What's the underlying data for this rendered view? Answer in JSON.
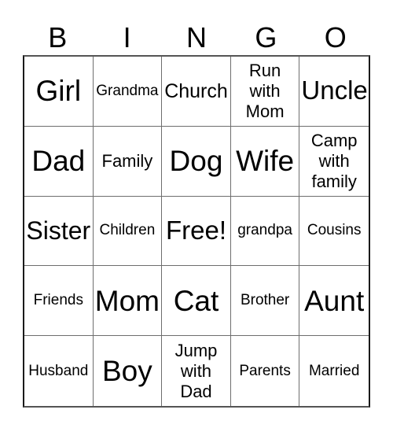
{
  "card": {
    "title": "BINGO",
    "header_letters": [
      "B",
      "I",
      "N",
      "G",
      "O"
    ],
    "rows": 5,
    "columns": 5,
    "free_space": "Free!",
    "colors": {
      "background": "#ffffff",
      "text": "#000000",
      "outer_border": "#1a1a1a",
      "inner_grid_line": "#6e6e6e"
    },
    "cells": [
      {
        "text": "Girl",
        "size": "xl",
        "multiline": false
      },
      {
        "text": "Grandma",
        "size": "sm",
        "multiline": false
      },
      {
        "text": "Church",
        "size": "lg",
        "multiline": false
      },
      {
        "text": "Run\nwith\nMom",
        "size": "md",
        "multiline": true
      },
      {
        "text": "Uncle",
        "size": "xl",
        "multiline": false
      },
      {
        "text": "Dad",
        "size": "xl",
        "multiline": false
      },
      {
        "text": "Family",
        "size": "md",
        "multiline": false
      },
      {
        "text": "Dog",
        "size": "xl",
        "multiline": false
      },
      {
        "text": "Wife",
        "size": "xl",
        "multiline": false
      },
      {
        "text": "Camp\nwith\nfamily",
        "size": "md",
        "multiline": true
      },
      {
        "text": "Sister",
        "size": "lg",
        "multiline": false
      },
      {
        "text": "Children",
        "size": "sm",
        "multiline": false
      },
      {
        "text": "Free!",
        "size": "lg",
        "multiline": false
      },
      {
        "text": "grandpa",
        "size": "sm",
        "multiline": false
      },
      {
        "text": "Cousins",
        "size": "sm",
        "multiline": false
      },
      {
        "text": "Friends",
        "size": "sm",
        "multiline": false
      },
      {
        "text": "Mom",
        "size": "xl",
        "multiline": false
      },
      {
        "text": "Cat",
        "size": "xl",
        "multiline": false
      },
      {
        "text": "Brother",
        "size": "sm",
        "multiline": false
      },
      {
        "text": "Aunt",
        "size": "xl",
        "multiline": false
      },
      {
        "text": "Husband",
        "size": "sm",
        "multiline": false
      },
      {
        "text": "Boy",
        "size": "xl",
        "multiline": false
      },
      {
        "text": "Jump\nwith\nDad",
        "size": "md",
        "multiline": true
      },
      {
        "text": "Parents",
        "size": "sm",
        "multiline": false
      },
      {
        "text": "Married",
        "size": "sm",
        "multiline": false
      }
    ]
  }
}
